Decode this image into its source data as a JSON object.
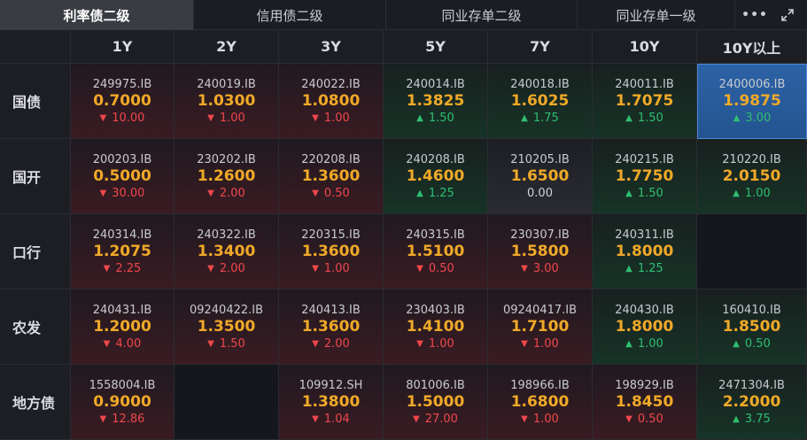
{
  "tabs": [
    "利率债二级",
    "信用债二级",
    "同业存单二级",
    "同业存单一级"
  ],
  "tools": {
    "more_icon": "more-horizontal-icon",
    "expand_icon": "expand-icon",
    "more_glyph": "•••"
  },
  "columns": [
    "1Y",
    "2Y",
    "3Y",
    "5Y",
    "7Y",
    "10Y",
    "10Y以上"
  ],
  "colors": {
    "yield": "#f0a928",
    "down": "#f0474c",
    "up": "#2fbf71",
    "selected": "#2c62a6"
  },
  "rows": [
    {
      "label": "国债",
      "cells": [
        {
          "code": "249975.IB",
          "yield": "0.7000",
          "change": "10.00",
          "dir": "down"
        },
        {
          "code": "240019.IB",
          "yield": "1.0300",
          "change": "1.00",
          "dir": "down"
        },
        {
          "code": "240022.IB",
          "yield": "1.0800",
          "change": "1.00",
          "dir": "down"
        },
        {
          "code": "240014.IB",
          "yield": "1.3825",
          "change": "1.50",
          "dir": "up"
        },
        {
          "code": "240018.IB",
          "yield": "1.6025",
          "change": "1.75",
          "dir": "up"
        },
        {
          "code": "240011.IB",
          "yield": "1.7075",
          "change": "1.50",
          "dir": "up"
        },
        {
          "code": "2400006.IB",
          "yield": "1.9875",
          "change": "3.00",
          "dir": "up",
          "selected": true
        }
      ]
    },
    {
      "label": "国开",
      "cells": [
        {
          "code": "200203.IB",
          "yield": "0.5000",
          "change": "30.00",
          "dir": "down"
        },
        {
          "code": "230202.IB",
          "yield": "1.2600",
          "change": "2.00",
          "dir": "down"
        },
        {
          "code": "220208.IB",
          "yield": "1.3600",
          "change": "0.50",
          "dir": "down"
        },
        {
          "code": "240208.IB",
          "yield": "1.4600",
          "change": "1.25",
          "dir": "up"
        },
        {
          "code": "210205.IB",
          "yield": "1.6500",
          "change": "0.00",
          "dir": "flat"
        },
        {
          "code": "240215.IB",
          "yield": "1.7750",
          "change": "1.50",
          "dir": "up"
        },
        {
          "code": "210220.IB",
          "yield": "2.0150",
          "change": "1.00",
          "dir": "up"
        }
      ]
    },
    {
      "label": "口行",
      "cells": [
        {
          "code": "240314.IB",
          "yield": "1.2075",
          "change": "2.25",
          "dir": "down"
        },
        {
          "code": "240322.IB",
          "yield": "1.3400",
          "change": "2.00",
          "dir": "down"
        },
        {
          "code": "220315.IB",
          "yield": "1.3600",
          "change": "1.00",
          "dir": "down"
        },
        {
          "code": "240315.IB",
          "yield": "1.5100",
          "change": "0.50",
          "dir": "down"
        },
        {
          "code": "230307.IB",
          "yield": "1.5800",
          "change": "3.00",
          "dir": "down"
        },
        {
          "code": "240311.IB",
          "yield": "1.8000",
          "change": "1.25",
          "dir": "up"
        },
        null
      ]
    },
    {
      "label": "农发",
      "cells": [
        {
          "code": "240431.IB",
          "yield": "1.2000",
          "change": "4.00",
          "dir": "down"
        },
        {
          "code": "09240422.IB",
          "yield": "1.3500",
          "change": "1.50",
          "dir": "down"
        },
        {
          "code": "240413.IB",
          "yield": "1.3600",
          "change": "2.00",
          "dir": "down"
        },
        {
          "code": "230403.IB",
          "yield": "1.4100",
          "change": "1.00",
          "dir": "down"
        },
        {
          "code": "09240417.IB",
          "yield": "1.7100",
          "change": "1.00",
          "dir": "down"
        },
        {
          "code": "240430.IB",
          "yield": "1.8000",
          "change": "1.00",
          "dir": "up"
        },
        {
          "code": "160410.IB",
          "yield": "1.8500",
          "change": "0.50",
          "dir": "up"
        }
      ]
    },
    {
      "label": "地方债",
      "cells": [
        {
          "code": "1558004.IB",
          "yield": "0.9000",
          "change": "12.86",
          "dir": "down"
        },
        null,
        {
          "code": "109912.SH",
          "yield": "1.3800",
          "change": "1.04",
          "dir": "down"
        },
        {
          "code": "801006.IB",
          "yield": "1.5000",
          "change": "27.00",
          "dir": "down"
        },
        {
          "code": "198966.IB",
          "yield": "1.6800",
          "change": "1.00",
          "dir": "down"
        },
        {
          "code": "198929.IB",
          "yield": "1.8450",
          "change": "0.50",
          "dir": "down"
        },
        {
          "code": "2471304.IB",
          "yield": "2.2000",
          "change": "3.75",
          "dir": "up"
        }
      ]
    }
  ]
}
